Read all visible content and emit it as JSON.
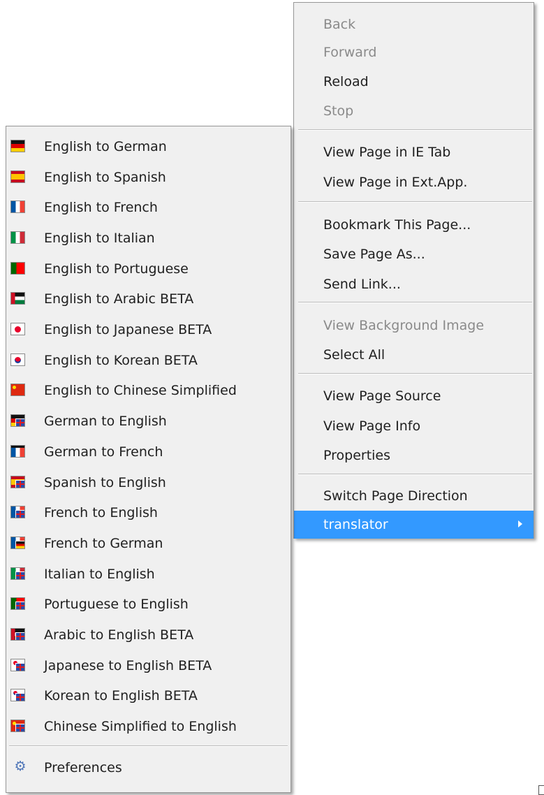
{
  "context_menu": {
    "items": [
      {
        "label": "Back",
        "disabled": true
      },
      {
        "label": "Forward",
        "disabled": true
      },
      {
        "label": "Reload",
        "disabled": false
      },
      {
        "label": "Stop",
        "disabled": true
      },
      {
        "label": "View Page in IE Tab",
        "disabled": false
      },
      {
        "label": "View Page in Ext.App.",
        "disabled": false
      },
      {
        "label": "Bookmark This Page...",
        "disabled": false
      },
      {
        "label": "Save Page As...",
        "disabled": false
      },
      {
        "label": "Send Link...",
        "disabled": false
      },
      {
        "label": "View Background Image",
        "disabled": true
      },
      {
        "label": "Select All",
        "disabled": false
      },
      {
        "label": "View Page Source",
        "disabled": false
      },
      {
        "label": "View Page Info",
        "disabled": false
      },
      {
        "label": "Properties",
        "disabled": false
      },
      {
        "label": "Switch Page Direction",
        "disabled": false
      },
      {
        "label": "translator",
        "disabled": false,
        "highlighted": true,
        "has_submenu": true
      }
    ],
    "highlight_color": "#3399ff",
    "disabled_color": "#8a8a8a"
  },
  "translator_submenu": {
    "items": [
      {
        "label": "English to German",
        "icon": "flag-de-icon"
      },
      {
        "label": "English to Spanish",
        "icon": "flag-es-icon"
      },
      {
        "label": "English to French",
        "icon": "flag-fr-icon"
      },
      {
        "label": "English to Italian",
        "icon": "flag-it-icon"
      },
      {
        "label": "English to Portuguese",
        "icon": "flag-pt-icon"
      },
      {
        "label": "English to Arabic BETA",
        "icon": "flag-ar-icon"
      },
      {
        "label": "English to Japanese BETA",
        "icon": "flag-jp-icon"
      },
      {
        "label": "English to Korean BETA",
        "icon": "flag-kr-icon"
      },
      {
        "label": "English to Chinese Simplified",
        "icon": "flag-cn-icon"
      },
      {
        "label": "German to English",
        "icon": "flag-de-en-icon"
      },
      {
        "label": "German to French",
        "icon": "flag-de-fr-icon"
      },
      {
        "label": "Spanish to English",
        "icon": "flag-es-en-icon"
      },
      {
        "label": "French to English",
        "icon": "flag-fr-en-icon"
      },
      {
        "label": "French to German",
        "icon": "flag-fr-de-icon"
      },
      {
        "label": "Italian to English",
        "icon": "flag-it-en-icon"
      },
      {
        "label": "Portuguese to English",
        "icon": "flag-pt-en-icon"
      },
      {
        "label": "Arabic to English BETA",
        "icon": "flag-ar-en-icon"
      },
      {
        "label": "Japanese to English BETA",
        "icon": "flag-jp-en-icon"
      },
      {
        "label": "Korean to English BETA",
        "icon": "flag-kr-en-icon"
      },
      {
        "label": "Chinese Simplified to English",
        "icon": "flag-cn-en-icon"
      }
    ],
    "preferences_label": "Preferences",
    "preferences_icon": "gear-icon"
  }
}
